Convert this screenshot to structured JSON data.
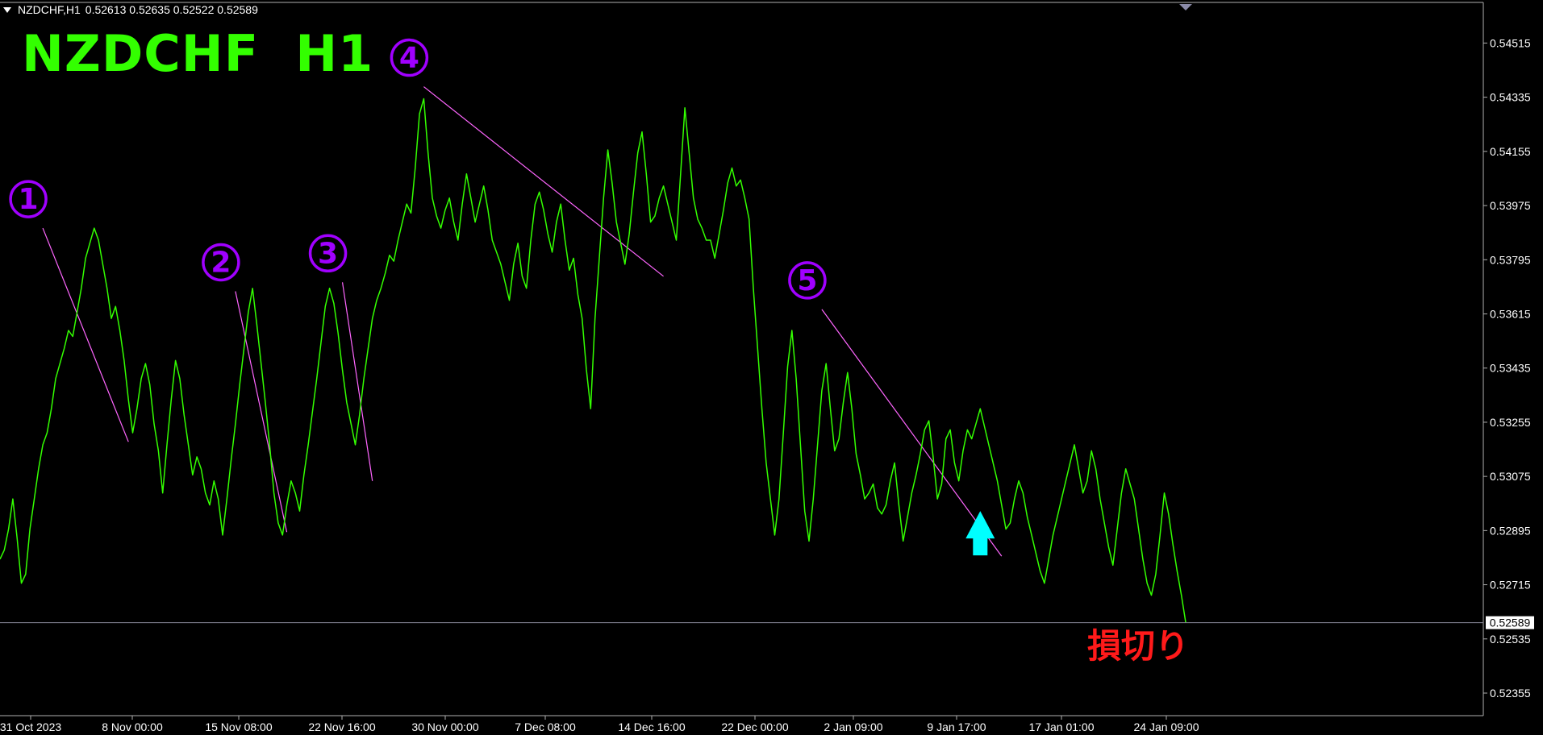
{
  "header": {
    "symbol_timeframe": "NZDCHF,H1",
    "ohlc": "0.52613 0.52635 0.52522 0.52589"
  },
  "title": "NZDCHF  H1",
  "stop_loss_label": "損切り",
  "colors": {
    "background": "#000000",
    "price_line": "#33ff00",
    "trendline": "#ff66ff",
    "label_circles": "#a000ff",
    "entry_arrow": "#00ffff",
    "title": "#33ff00",
    "stop_loss_text": "#ff1a1a"
  },
  "markers": {
    "wave_labels": [
      "1",
      "2",
      "3",
      "4",
      "5"
    ],
    "entry_arrow_icon": "up-arrow-icon"
  },
  "chart_data": {
    "type": "line",
    "series": [
      {
        "values": [
          0.528,
          0.5283,
          0.529,
          0.53,
          0.5287,
          0.5272,
          0.5275,
          0.529,
          0.53,
          0.531,
          0.5318,
          0.5322,
          0.533,
          0.534,
          0.5345,
          0.535,
          0.5356,
          0.5354,
          0.5362,
          0.537,
          0.538,
          0.5385,
          0.539,
          0.5386,
          0.5378,
          0.537,
          0.536,
          0.5364,
          0.5356,
          0.5346,
          0.5333,
          0.5322,
          0.533,
          0.534,
          0.5345,
          0.5338,
          0.5325,
          0.5316,
          0.5302,
          0.5318,
          0.5333,
          0.5346,
          0.534,
          0.5328,
          0.5318,
          0.5308,
          0.5314,
          0.531,
          0.5302,
          0.5298,
          0.5306,
          0.53,
          0.5288,
          0.53,
          0.5313,
          0.5325,
          0.5338,
          0.535,
          0.5362,
          0.537,
          0.5358,
          0.5345,
          0.5332,
          0.5318,
          0.5302,
          0.5292,
          0.5288,
          0.5298,
          0.5306,
          0.5302,
          0.5296,
          0.5308,
          0.5318,
          0.5329,
          0.534,
          0.5352,
          0.5364,
          0.537,
          0.5365,
          0.5355,
          0.5343,
          0.5332,
          0.5325,
          0.5318,
          0.5328,
          0.534,
          0.535,
          0.536,
          0.5366,
          0.537,
          0.5375,
          0.5381,
          0.5379,
          0.5386,
          0.5392,
          0.5398,
          0.5395,
          0.541,
          0.5428,
          0.5433,
          0.5415,
          0.54,
          0.5394,
          0.539,
          0.5396,
          0.54,
          0.5392,
          0.5386,
          0.5398,
          0.5408,
          0.54,
          0.5392,
          0.5398,
          0.5404,
          0.5396,
          0.5386,
          0.5382,
          0.5378,
          0.5372,
          0.5366,
          0.5378,
          0.5385,
          0.5374,
          0.537,
          0.5386,
          0.5398,
          0.5402,
          0.5396,
          0.5388,
          0.5382,
          0.5392,
          0.5398,
          0.5386,
          0.5376,
          0.538,
          0.5368,
          0.536,
          0.5343,
          0.533,
          0.536,
          0.538,
          0.54,
          0.5416,
          0.5405,
          0.5392,
          0.5385,
          0.5378,
          0.5388,
          0.5402,
          0.5415,
          0.5422,
          0.5408,
          0.5392,
          0.5394,
          0.54,
          0.5404,
          0.5398,
          0.5392,
          0.5386,
          0.5408,
          0.543,
          0.5415,
          0.54,
          0.5393,
          0.539,
          0.5386,
          0.5386,
          0.538,
          0.5388,
          0.5396,
          0.5405,
          0.541,
          0.5404,
          0.5406,
          0.54,
          0.5393,
          0.537,
          0.535,
          0.533,
          0.5312,
          0.53,
          0.5288,
          0.53,
          0.5322,
          0.5344,
          0.5356,
          0.534,
          0.5318,
          0.5296,
          0.5286,
          0.53,
          0.5318,
          0.5336,
          0.5345,
          0.533,
          0.5316,
          0.532,
          0.5332,
          0.5342,
          0.533,
          0.5315,
          0.5308,
          0.53,
          0.5302,
          0.5305,
          0.5297,
          0.5295,
          0.5298,
          0.5306,
          0.5312,
          0.5298,
          0.5286,
          0.5294,
          0.5302,
          0.5308,
          0.5315,
          0.5323,
          0.5326,
          0.5314,
          0.53,
          0.5305,
          0.532,
          0.5323,
          0.5312,
          0.5306,
          0.5316,
          0.5323,
          0.532,
          0.5325,
          0.533,
          0.5324,
          0.5318,
          0.5312,
          0.5306,
          0.5298,
          0.529,
          0.5292,
          0.53,
          0.5306,
          0.5302,
          0.5294,
          0.5288,
          0.5282,
          0.5276,
          0.5272,
          0.528,
          0.5288,
          0.5294,
          0.53,
          0.5306,
          0.5312,
          0.5318,
          0.531,
          0.5302,
          0.5306,
          0.5316,
          0.531,
          0.53,
          0.5292,
          0.5284,
          0.5278,
          0.529,
          0.5302,
          0.531,
          0.5305,
          0.53,
          0.529,
          0.528,
          0.5272,
          0.5268,
          0.5275,
          0.5288,
          0.5302,
          0.5295,
          0.5285,
          0.5276,
          0.5268,
          0.5259
        ]
      }
    ],
    "x_tick_labels": [
      "31 Oct 2023",
      "8 Nov 00:00",
      "15 Nov 08:00",
      "22 Nov 16:00",
      "30 Nov 00:00",
      "7 Dec 08:00",
      "14 Dec 16:00",
      "22 Dec 00:00",
      "2 Jan 09:00",
      "9 Jan 17:00",
      "17 Jan 01:00",
      "24 Jan 09:00"
    ],
    "y_tick_labels": [
      "0.54515",
      "0.54335",
      "0.54155",
      "0.53975",
      "0.53795",
      "0.53615",
      "0.53435",
      "0.53255",
      "0.53075",
      "0.52895",
      "0.52715",
      "0.52535",
      "0.52355"
    ],
    "y_tick_values": [
      0.54515,
      0.54335,
      0.54155,
      0.53975,
      0.53795,
      0.53615,
      0.53435,
      0.53255,
      0.53075,
      0.52895,
      0.52715,
      0.52535,
      0.52355
    ],
    "current_price": "0.52589",
    "current_price_value": 0.52589,
    "ylim": [
      0.5228,
      0.5465
    ],
    "trendlines": [
      {
        "label": "1",
        "from_bar": 10,
        "from_price": 0.539,
        "to_bar": 30,
        "to_price": 0.5319
      },
      {
        "label": "2",
        "from_bar": 55,
        "from_price": 0.5369,
        "to_bar": 67,
        "to_price": 0.5289
      },
      {
        "label": "3",
        "from_bar": 80,
        "from_price": 0.5372,
        "to_bar": 87,
        "to_price": 0.5306
      },
      {
        "label": "4",
        "from_bar": 99,
        "from_price": 0.5437,
        "to_bar": 155,
        "to_price": 0.5374
      },
      {
        "label": "5",
        "from_bar": 192,
        "from_price": 0.5363,
        "to_bar": 234,
        "to_price": 0.5281
      }
    ],
    "entry_arrow": {
      "bar": 229,
      "price": 0.5296
    }
  }
}
